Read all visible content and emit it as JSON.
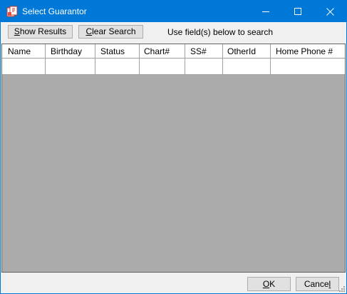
{
  "window": {
    "title": "Select Guarantor",
    "icon": "app-icon"
  },
  "toolbar": {
    "show_results_label": "Show Results",
    "show_results_mnemonic": "S",
    "clear_search_label": "Clear Search",
    "clear_search_mnemonic": "C",
    "hint": "Use field(s) below to search"
  },
  "grid": {
    "columns": [
      "Name",
      "Birthday",
      "Status",
      "Chart#",
      "SS#",
      "OtherId",
      "Home Phone #"
    ],
    "search_row": [
      "",
      "",
      "",
      "",
      "",
      "",
      ""
    ]
  },
  "footer": {
    "ok_label": "OK",
    "cancel_label": "Cancel"
  },
  "colors": {
    "titlebar": "#0078d7",
    "grid_background": "#ababab",
    "button_face": "#e1e1e1"
  }
}
